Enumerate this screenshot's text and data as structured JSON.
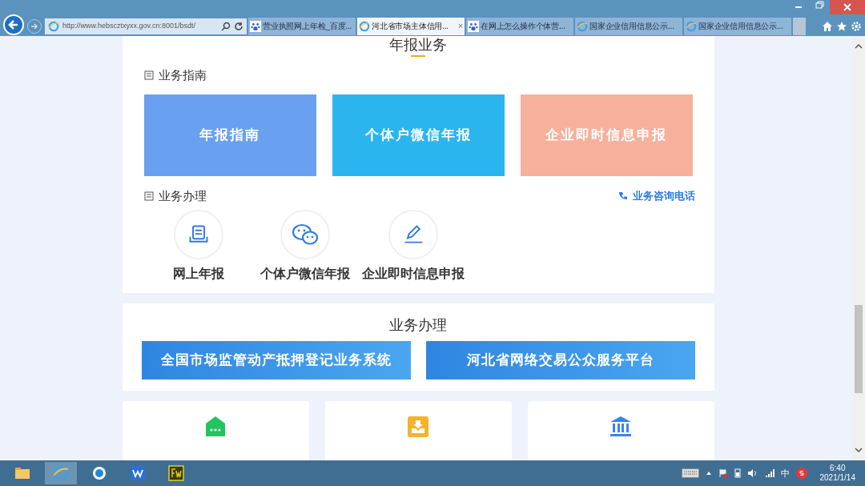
{
  "browser": {
    "address": "http://www.hebscztxyxx.gov.cn:8001/bsdt/",
    "tabs": [
      {
        "title": "营业执照网上年检_百度...",
        "kind": "paw",
        "selected": false
      },
      {
        "title": "河北省市场主体信用...",
        "kind": "ie",
        "selected": true,
        "close": "×"
      },
      {
        "title": "在网上怎么操作个体营...",
        "kind": "paw",
        "selected": false
      },
      {
        "title": "国家企业信用信息公示...",
        "kind": "ie",
        "selected": false
      },
      {
        "title": "国家企业信用信息公示...",
        "kind": "ie",
        "selected": false
      }
    ]
  },
  "annual": {
    "title": "年报业务",
    "guide_heading": "业务指南",
    "banners": [
      {
        "label": "年报指南",
        "color": "#6aa0f0"
      },
      {
        "label": "个体户微信年报",
        "color": "#2bb5ee"
      },
      {
        "label": "企业即时信息申报",
        "color": "#f6b09c"
      }
    ],
    "handle_heading": "业务办理",
    "hotline": "业务咨询电话",
    "services": [
      {
        "label": "网上年报",
        "kind": "report"
      },
      {
        "label": "个体户微信年报",
        "kind": "wechat"
      },
      {
        "label": "企业即时信息申报",
        "kind": "edit"
      }
    ]
  },
  "business": {
    "title": "业务办理",
    "links": [
      {
        "label": "全国市场监管动产抵押登记业务系统"
      },
      {
        "label": "河北省网络交易公众服务平台"
      }
    ]
  },
  "tiles": [
    {
      "kind": "notice",
      "color": "#22c55e"
    },
    {
      "kind": "download",
      "color": "#f4b32a"
    },
    {
      "kind": "bank",
      "color": "#3b82f6"
    }
  ],
  "taskbar": {
    "tray_lang": "中",
    "time": "6:40",
    "date": "2021/1/14"
  }
}
